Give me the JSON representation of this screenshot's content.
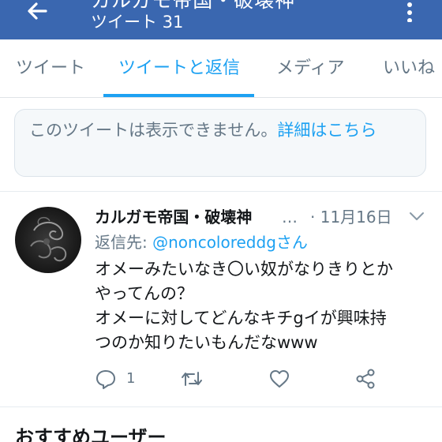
{
  "header": {
    "title": "カルガモ帝国・破壊神",
    "subtitle": "ツイート 31",
    "back_icon": "arrow-left-icon",
    "more_icon": "more-vertical-icon",
    "background_color": "#3a67b0"
  },
  "tabs": [
    {
      "label": "ツイート",
      "active": false
    },
    {
      "label": "ツイートと返信",
      "active": true
    },
    {
      "label": "メディア",
      "active": false
    },
    {
      "label": "いいね",
      "active": false
    }
  ],
  "notice": {
    "text": "このツイートは表示できません。",
    "link": "詳細はこちら"
  },
  "tweet": {
    "author_name": "カルガモ帝国・破壊神",
    "ellipsis": "…",
    "date": "· 11月16日",
    "reply_prefix": "返信先:",
    "reply_handle": "@noncoloreddgさん",
    "lines": [
      "オメーみたいなき〇い奴がなりきりとか",
      "やってんの？",
      "オメーに対してどんなキチgイが興味持",
      "つのか知りたいもんだなwww"
    ],
    "reply_count": "1",
    "icons": [
      "reply-icon",
      "retweet-icon",
      "like-icon",
      "share-icon"
    ]
  },
  "section": {
    "title": "おすすめユーザー"
  },
  "colors": {
    "accent": "#1da1f2",
    "muted": "#657786",
    "text": "#14171a"
  }
}
